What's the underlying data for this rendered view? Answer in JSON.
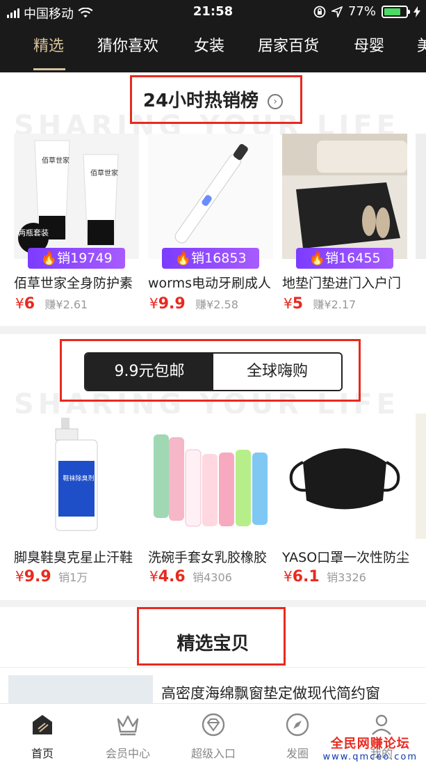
{
  "status_bar": {
    "carrier": "中国移动",
    "time": "21:58",
    "battery_pct": "77%"
  },
  "nav_tabs": [
    {
      "label": "精选",
      "active": true
    },
    {
      "label": "猜你喜欢",
      "active": false
    },
    {
      "label": "女装",
      "active": false
    },
    {
      "label": "居家百货",
      "active": false
    },
    {
      "label": "母婴",
      "active": false
    },
    {
      "label": "美",
      "active": false
    }
  ],
  "hot_section": {
    "title": "24小时热销榜",
    "watermark": "SHARING YOUR LIFE",
    "items": [
      {
        "name": "佰草世家全身防护素",
        "sales": "销19749",
        "price_symbol": "¥",
        "price": "6",
        "earn": "赚¥2.61",
        "tag": "两瓶套装"
      },
      {
        "name": "worms电动牙刷成人",
        "sales": "销16853",
        "price_symbol": "¥",
        "price": "9.9",
        "earn": "赚¥2.58"
      },
      {
        "name": "地垫门垫进门入户门",
        "sales": "销16455",
        "price_symbol": "¥",
        "price": "5",
        "earn": "赚¥2.17"
      }
    ]
  },
  "deal_section": {
    "segments": [
      "9.9元包邮",
      "全球嗨购"
    ],
    "watermark": "SHARING YOUR LIFE",
    "items": [
      {
        "name": "脚臭鞋臭克星止汗鞋",
        "price_symbol": "¥",
        "price": "9.9",
        "sold": "销1万",
        "product_label": "鞋袜除臭剂"
      },
      {
        "name": "洗碗手套女乳胶橡胶",
        "price_symbol": "¥",
        "price": "4.6",
        "sold": "销4306"
      },
      {
        "name": "YASO口罩一次性防尘",
        "price_symbol": "¥",
        "price": "6.1",
        "sold": "销3326"
      }
    ]
  },
  "picks_section": {
    "title": "精选宝贝",
    "first_item_title": "高密度海绵飘窗垫定做现代简约窗"
  },
  "bottom_nav": [
    {
      "label": "首页",
      "icon": "home-icon",
      "active": true
    },
    {
      "label": "会员中心",
      "icon": "crown-icon",
      "active": false
    },
    {
      "label": "超级入口",
      "icon": "diamond-icon",
      "active": false
    },
    {
      "label": "发圈",
      "icon": "compass-icon",
      "active": false
    },
    {
      "label": "我的",
      "icon": "user-icon",
      "active": false
    }
  ],
  "watermark_overlay": {
    "forum_name": "全民网赚论坛",
    "site": "www.qmceo.com"
  },
  "colors": {
    "accent_red": "#e8291f",
    "gold": "#d8c19a",
    "badge_purple": "#8a45ff",
    "battery_green": "#4cd964"
  }
}
